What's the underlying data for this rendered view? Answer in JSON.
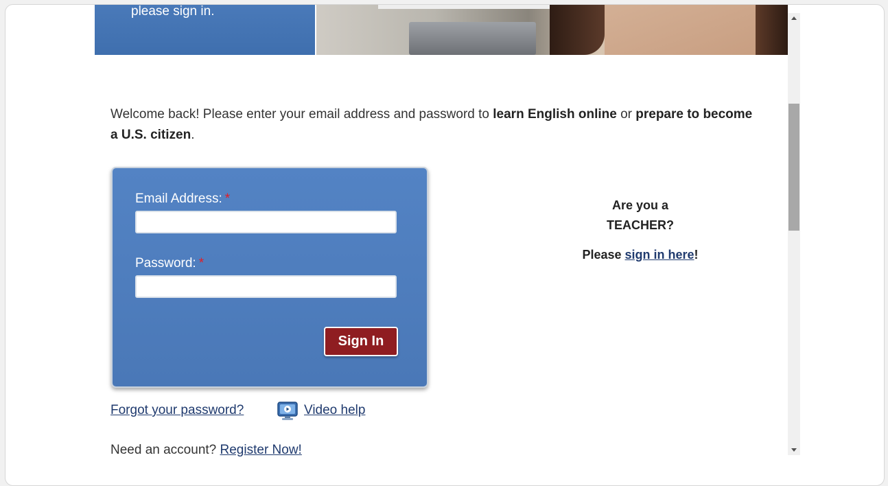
{
  "hero": {
    "text": "please sign in."
  },
  "welcome": {
    "prefix": "Welcome back! Please enter your email address and password to ",
    "bold1": "learn English online",
    "middle": " or ",
    "bold2": "prepare to become a U.S. citizen",
    "suffix": "."
  },
  "login": {
    "email_label": "Email Address:",
    "password_label": "Password:",
    "required_marker": "*",
    "email_value": "",
    "password_value": "",
    "signin_label": "Sign In"
  },
  "teacher": {
    "line1": "Are you a",
    "line2": "TEACHER?",
    "please": "Please ",
    "link_text": "sign in here",
    "exclaim": "!"
  },
  "links": {
    "forgot": "Forgot your password?",
    "video_help": "Video help",
    "video_icon": "monitor-play-icon",
    "need_account": "Need an account? ",
    "register": "Register Now!"
  },
  "colors": {
    "panel_blue": "#4a78b7",
    "button_red": "#8f1d21",
    "link": "#1f3a6e",
    "required": "#e51c23"
  }
}
